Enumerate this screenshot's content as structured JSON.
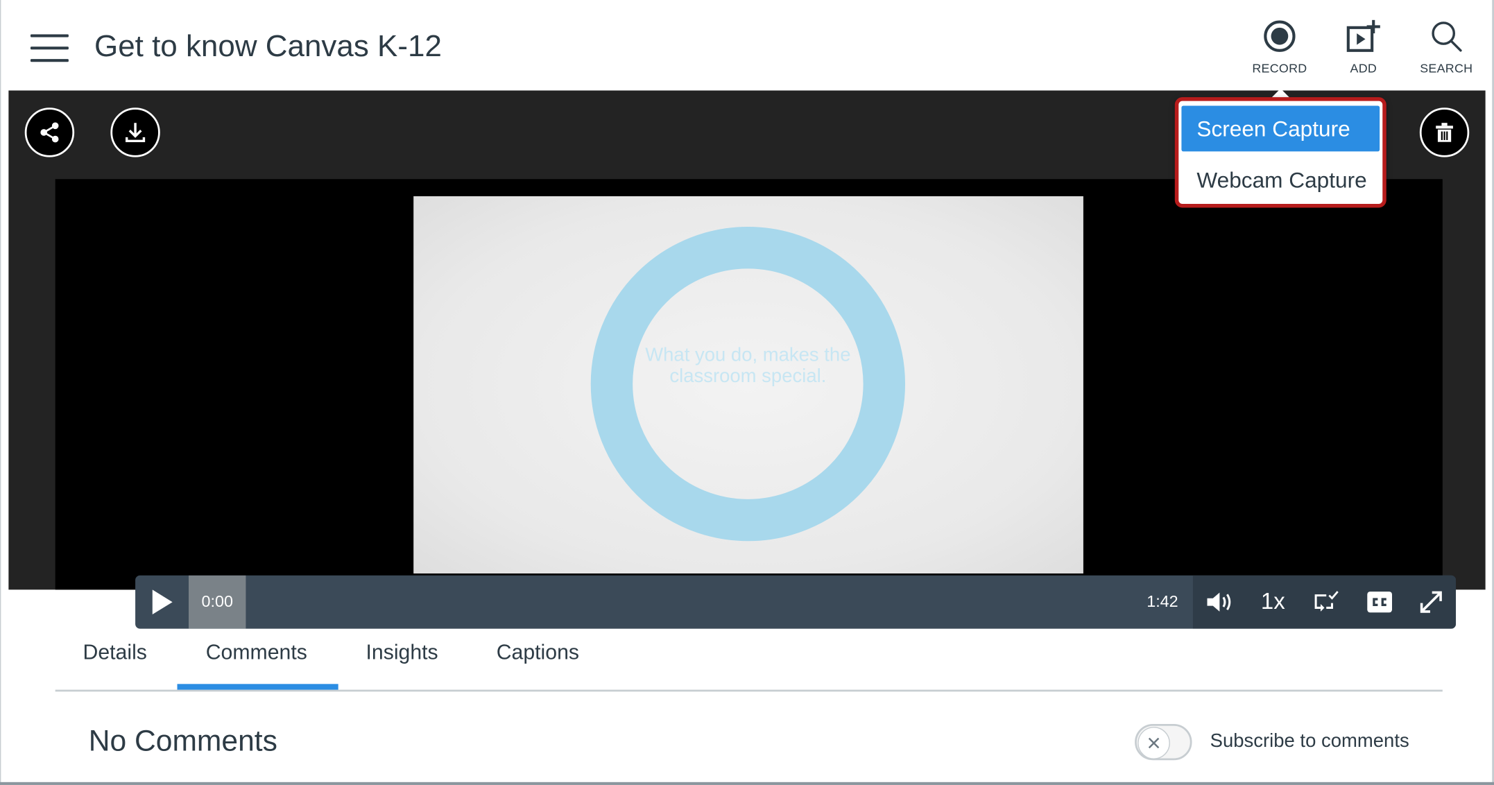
{
  "header": {
    "title": "Get to know Canvas K-12",
    "actions": [
      {
        "label": "RECORD",
        "icon": "record-icon"
      },
      {
        "label": "ADD",
        "icon": "add-media-icon"
      },
      {
        "label": "SEARCH",
        "icon": "search-icon"
      }
    ]
  },
  "record_menu": {
    "items": [
      "Screen Capture",
      "Webcam Capture"
    ],
    "selected": "Screen Capture",
    "highlight_color": "#2b8de3",
    "outline_color": "#b71c1c"
  },
  "player": {
    "icons": [
      "share-icon",
      "download-icon",
      "trash-icon"
    ],
    "video_text": "What you do, makes the classroom special.",
    "current_time": "0:00",
    "duration": "1:42",
    "progress": 0,
    "speed": "1x",
    "controls": [
      "play-icon",
      "volume-icon",
      "picture-in-picture-icon",
      "closed-captions-icon",
      "fullscreen-icon"
    ]
  },
  "tabs": {
    "items": [
      "Details",
      "Comments",
      "Insights",
      "Captions"
    ],
    "active": "Comments"
  },
  "comments": {
    "empty_text": "No Comments",
    "subscribe_label": "Subscribe to comments",
    "subscribed": false
  },
  "colors": {
    "accent": "#2b8de3",
    "text": "#2d3b45",
    "player_background": "#232323"
  }
}
